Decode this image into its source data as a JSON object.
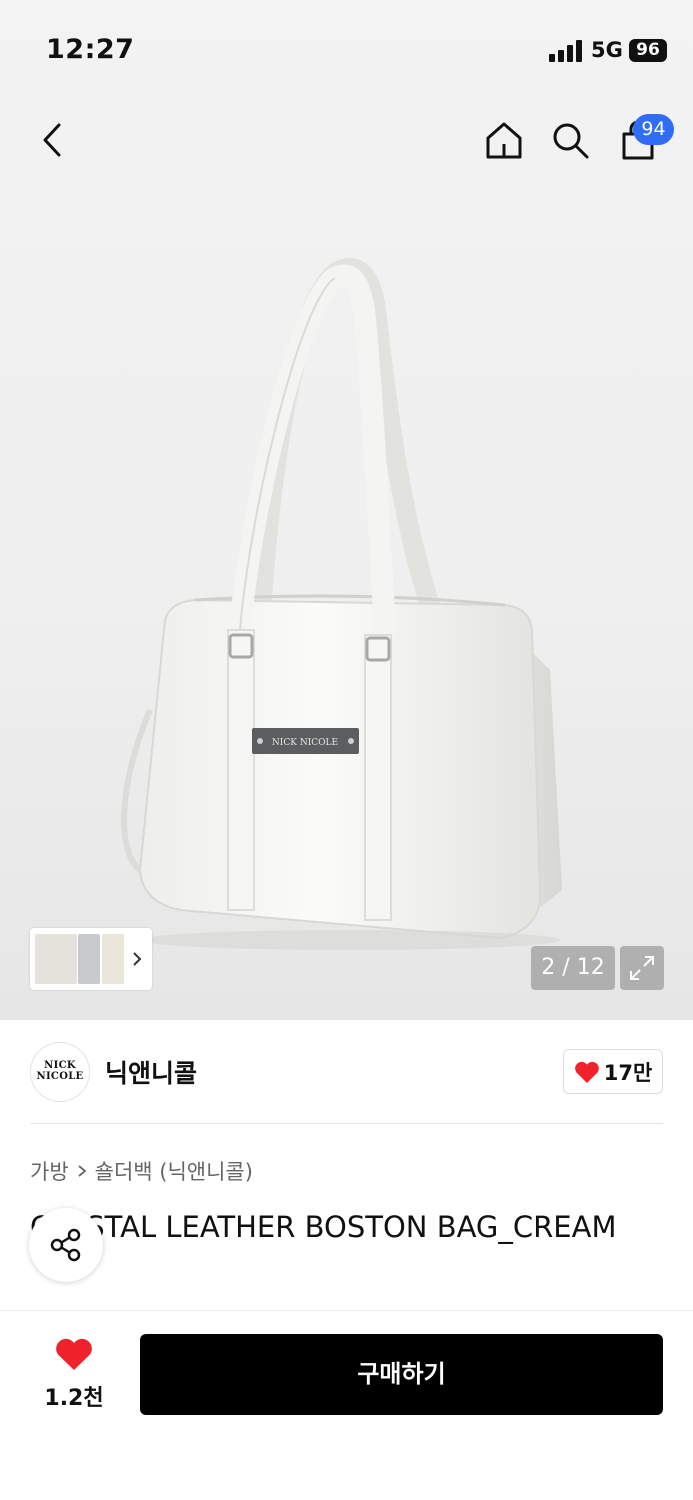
{
  "status_bar": {
    "time": "12:27",
    "network": "5G",
    "battery": "96"
  },
  "nav": {
    "cart_count": "94"
  },
  "gallery": {
    "counter": "2 / 12",
    "logo_plate_text": "NICK NICOLE"
  },
  "brand": {
    "logo_line1": "NICK",
    "logo_line2": "NICOLE",
    "name": "닉앤니콜",
    "likes": "17만"
  },
  "breadcrumb": {
    "category": "가방",
    "subcategory": "숄더백 (닉앤니콜)"
  },
  "product": {
    "title": "CRYSTAL LEATHER BOSTON BAG_CREAM"
  },
  "bottom_bar": {
    "wish_count": "1.2천",
    "buy_label": "구매하기"
  },
  "colors": {
    "accent": "#2f6df6",
    "heart": "#f0232d",
    "buy_bg": "#000000"
  }
}
